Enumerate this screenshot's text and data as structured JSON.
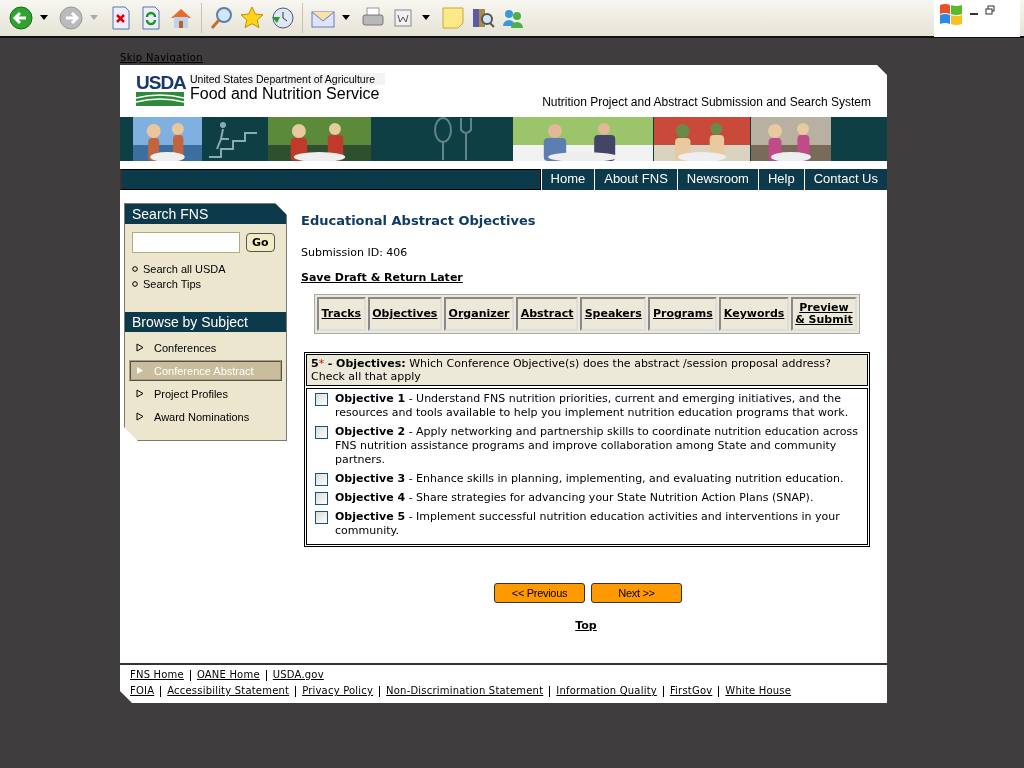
{
  "skip_link": "Skip Navigation",
  "header": {
    "logo_text": "USDA",
    "agency_line1": "United States Department of Agriculture",
    "agency_line2": "Food and Nutrition Service",
    "system_title": "Nutrition Project and Abstract Submission and Search System"
  },
  "banner": [
    {
      "kind": "picture"
    },
    {
      "kind": "stairs"
    },
    {
      "kind": "picture"
    },
    {
      "kind": "utensils"
    },
    {
      "kind": "picture"
    },
    {
      "kind": "picture"
    },
    {
      "kind": "picture"
    }
  ],
  "nav": [
    "Home",
    "About FNS",
    "Newsroom",
    "Help",
    "Contact Us"
  ],
  "sidebar": {
    "search_title": "Search FNS",
    "search_button": "Go",
    "search_links": [
      "Search all USDA",
      "Search Tips"
    ],
    "browse_title": "Browse by Subject",
    "browse_items": [
      {
        "label": "Conferences",
        "selected": false
      },
      {
        "label": "Conference Abstract",
        "selected": true
      },
      {
        "label": "Project Profiles",
        "selected": false
      },
      {
        "label": "Award Nominations",
        "selected": false
      }
    ]
  },
  "main": {
    "title": "Educational Abstract Objectives",
    "submission_id": "Submission ID: 406",
    "save_link": "Save Draft & Return Later",
    "steps": [
      "Tracks",
      "Objectives",
      "Organizer",
      "Abstract",
      "Speakers",
      "Programs",
      "Keywords",
      "Preview & Submit"
    ],
    "question": {
      "number": "5",
      "required_mark": "*",
      "text": "**- Objectives:** Which Conference Objective(s) does the abstract /session proposal address? Check all that apply"
    },
    "objectives": [
      {
        "title": "Objective 1",
        "text": "- Understand FNS nutrition priorities, current and emerging initiatives, and the resources and tools available to help you implement nutrition education programs that work.",
        "checked": false
      },
      {
        "title": "Objective 2",
        "text": "- Apply networking and partnership skills to coordinate nutrition education across FNS nutrition assistance programs and improve collaboration among State and community partners.",
        "checked": false
      },
      {
        "title": "Objective 3",
        "text": "- Enhance skills in planning, implementing, and evaluating nutrition education.",
        "checked": false
      },
      {
        "title": "Objective 4",
        "text": "- Share strategies for advancing your State Nutrition Action Plans (SNAP).",
        "checked": false
      },
      {
        "title": "Objective 5",
        "text": "- Implement successful nutrition education activities and interventions in your community.",
        "checked": false
      }
    ],
    "buttons": [
      "<< Previous",
      "Next >>"
    ],
    "top_link": "Top"
  },
  "footer": {
    "row_1": [
      "FNS Home",
      "OANE Home",
      "USDA.gov"
    ],
    "row_2": [
      "FOIA",
      "Accessibility Statement",
      "Privacy Policy",
      "Non-Discrimination Statement",
      "Information Quality",
      "FirstGov",
      "White House"
    ]
  }
}
